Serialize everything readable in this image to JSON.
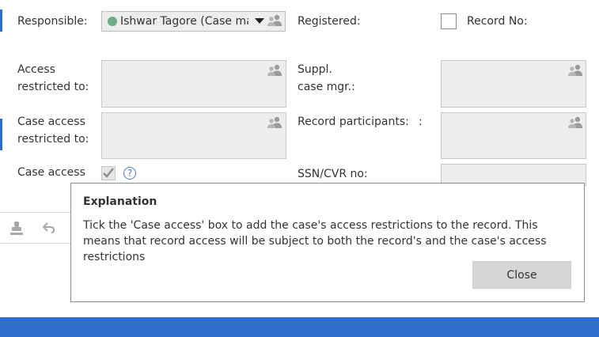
{
  "form": {
    "responsible_label": "Responsible:",
    "responsible_value": "Ishwar Tagore (Case manager)",
    "registered_label": "Registered:",
    "record_no_label": "Record No:",
    "access_restricted_label_1": "Access",
    "access_restricted_label_2": "restricted to:",
    "suppl_case_mgr_label_1": "Suppl.",
    "suppl_case_mgr_label_2": "case mgr.:",
    "case_access_restricted_label_1": "Case access",
    "case_access_restricted_label_2": "restricted to:",
    "record_participants_label": "Record participants:",
    "record_participants_colon": ":",
    "case_access_label": "Case access",
    "case_access_checked": true,
    "help_glyph": "?",
    "ssn_cvr_label": "SSN/CVR no:"
  },
  "dialog": {
    "title": "Explanation",
    "text": "Tick the 'Case access' box to add the case's access restrictions to the record. This means that record access will be subject to both the record's and the case's access restrictions",
    "close_label": "Close"
  },
  "icons": {
    "people": "people-icon",
    "help": "help-icon",
    "stamp": "stamp-icon",
    "undo": "undo-icon",
    "status_dot": "status-dot"
  },
  "colors": {
    "status_dot": "#6fae84",
    "bottom_bar": "#2e6ecf",
    "field_bg": "#ededed",
    "button_bg": "#d6d6d6"
  }
}
